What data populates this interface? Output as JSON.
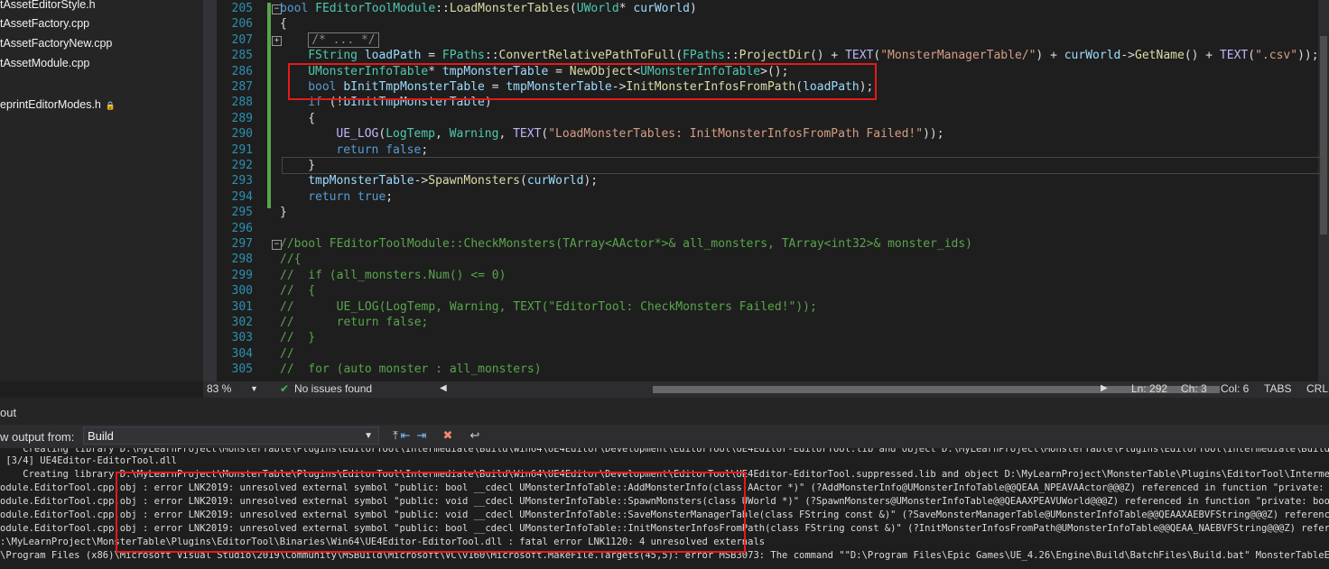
{
  "explorer": {
    "items": [
      {
        "label": "tAssetEditorStyle.h",
        "locked": false
      },
      {
        "label": "tAssetFactory.cpp",
        "locked": false
      },
      {
        "label": "tAssetFactoryNew.cpp",
        "locked": false
      },
      {
        "label": "tAssetModule.cpp",
        "locked": false
      },
      {
        "label": "eprintEditorModes.h",
        "locked": true
      }
    ]
  },
  "editor": {
    "lines": [
      {
        "n": "205",
        "segs": [
          [
            "kw",
            "bool "
          ],
          [
            "ty",
            "FEditorToolModule"
          ],
          [
            "",
            "::"
          ],
          [
            "fn",
            "LoadMonsterTables"
          ],
          [
            "",
            "("
          ],
          [
            "ty",
            "UWorld"
          ],
          [
            "",
            "* "
          ],
          [
            "var",
            "curWorld"
          ],
          [
            "",
            ")"
          ]
        ]
      },
      {
        "n": "206",
        "segs": [
          [
            "",
            "{"
          ]
        ]
      },
      {
        "n": "207",
        "segs": [
          [
            "box",
            "/* ... */"
          ]
        ]
      },
      {
        "n": "285",
        "segs": [
          [
            "ty",
            "FString "
          ],
          [
            "var",
            "loadPath"
          ],
          [
            "",
            " = "
          ],
          [
            "ty",
            "FPaths"
          ],
          [
            "",
            "::"
          ],
          [
            "fn",
            "ConvertRelativePathToFull"
          ],
          [
            "",
            "("
          ],
          [
            "ty",
            "FPaths"
          ],
          [
            "",
            "::"
          ],
          [
            "fn",
            "ProjectDir"
          ],
          [
            "",
            "() + "
          ],
          [
            "mac",
            "TEXT"
          ],
          [
            "",
            "("
          ],
          [
            "str",
            "\"MonsterManagerTable/\""
          ],
          [
            "",
            ") + "
          ],
          [
            "var",
            "curWorld"
          ],
          [
            "",
            "->"
          ],
          [
            "fn",
            "GetName"
          ],
          [
            "",
            "() + "
          ],
          [
            "mac",
            "TEXT"
          ],
          [
            "",
            "("
          ],
          [
            "str",
            "\".csv\""
          ],
          [
            "",
            "));"
          ]
        ]
      },
      {
        "n": "286",
        "segs": [
          [
            "ty",
            "UMonsterInfoTable"
          ],
          [
            "",
            "* "
          ],
          [
            "var",
            "tmpMonsterTable"
          ],
          [
            "",
            " = "
          ],
          [
            "fn",
            "NewObject"
          ],
          [
            "",
            "<"
          ],
          [
            "ty",
            "UMonsterInfoTable"
          ],
          [
            "",
            ">();"
          ]
        ]
      },
      {
        "n": "287",
        "segs": [
          [
            "kw",
            "bool "
          ],
          [
            "var",
            "bInitTmpMonsterTable"
          ],
          [
            "",
            " = "
          ],
          [
            "var",
            "tmpMonsterTable"
          ],
          [
            "",
            "->"
          ],
          [
            "fn",
            "InitMonsterInfosFromPath"
          ],
          [
            "",
            "("
          ],
          [
            "var",
            "loadPath"
          ],
          [
            "",
            ");"
          ]
        ]
      },
      {
        "n": "288",
        "segs": [
          [
            "kw",
            "if "
          ],
          [
            "",
            "(!"
          ],
          [
            "var",
            "bInitTmpMonsterTable"
          ],
          [
            "",
            ")"
          ]
        ]
      },
      {
        "n": "289",
        "segs": [
          [
            "",
            "{"
          ]
        ]
      },
      {
        "n": "290",
        "segs": [
          [
            "mac",
            "UE_LOG"
          ],
          [
            "",
            "("
          ],
          [
            "ty",
            "LogTemp"
          ],
          [
            "",
            ", "
          ],
          [
            "ty",
            "Warning"
          ],
          [
            "",
            ", "
          ],
          [
            "mac",
            "TEXT"
          ],
          [
            "",
            "("
          ],
          [
            "str",
            "\"LoadMonsterTables: InitMonsterInfosFromPath Failed!\""
          ],
          [
            "",
            "));"
          ]
        ]
      },
      {
        "n": "291",
        "segs": [
          [
            "kw",
            "return "
          ],
          [
            "kw",
            "false"
          ],
          [
            "",
            ";"
          ]
        ]
      },
      {
        "n": "292",
        "segs": [
          [
            "",
            "}"
          ]
        ]
      },
      {
        "n": "293",
        "segs": [
          [
            "var",
            "tmpMonsterTable"
          ],
          [
            "",
            "->"
          ],
          [
            "fn",
            "SpawnMonsters"
          ],
          [
            "",
            "("
          ],
          [
            "var",
            "curWorld"
          ],
          [
            "",
            ");"
          ]
        ]
      },
      {
        "n": "294",
        "segs": [
          [
            "kw",
            "return "
          ],
          [
            "kw",
            "true"
          ],
          [
            "",
            ";"
          ]
        ]
      },
      {
        "n": "295",
        "segs": [
          [
            "",
            "}"
          ]
        ]
      },
      {
        "n": "296",
        "segs": []
      },
      {
        "n": "297",
        "segs": [
          [
            "cm",
            "//bool FEditorToolModule::CheckMonsters(TArray<AActor*>& all_monsters, TArray<int32>& monster_ids)"
          ]
        ]
      },
      {
        "n": "298",
        "segs": [
          [
            "cm",
            "//{"
          ]
        ]
      },
      {
        "n": "299",
        "segs": [
          [
            "cm",
            "//  if (all_monsters.Num() <= 0)"
          ]
        ]
      },
      {
        "n": "300",
        "segs": [
          [
            "cm",
            "//  {"
          ]
        ]
      },
      {
        "n": "301",
        "segs": [
          [
            "cm",
            "//      UE_LOG(LogTemp, Warning, TEXT(\"EditorTool: CheckMonsters Failed!\"));"
          ]
        ]
      },
      {
        "n": "302",
        "segs": [
          [
            "cm",
            "//      return false;"
          ]
        ]
      },
      {
        "n": "303",
        "segs": [
          [
            "cm",
            "//  }"
          ]
        ]
      },
      {
        "n": "304",
        "segs": [
          [
            "cm",
            "//"
          ]
        ]
      },
      {
        "n": "305",
        "segs": [
          [
            "cm",
            "//  for (auto monster : all_monsters)"
          ]
        ]
      }
    ]
  },
  "status": {
    "zoom": "83 %",
    "issues": "No issues found",
    "ln": "Ln: 292",
    "ch": "Ch: 3",
    "col": "Col: 6",
    "tabs": "TABS",
    "eol": "CRLF"
  },
  "output": {
    "title": "out",
    "from_label": "w output from:",
    "source": "Build",
    "lines": [
      "    Creating library D:\\MyLearnProject\\MonsterTable\\Plugins\\EditorTool\\Intermediate\\Build\\Win64\\UE4Editor\\Development\\EditorTool\\UE4Editor-EditorTool.lib and object D:\\MyLearnProject\\MonsterTable\\Plugins\\EditorTool\\Intermediate\\Build\\Win64\\UE4Edi",
      " [3/4] UE4Editor-EditorTool.dll",
      "    Creating library D:\\MyLearnProject\\MonsterTable\\Plugins\\EditorTool\\Intermediate\\Build\\Win64\\UE4Editor\\Development\\EditorTool\\UE4Editor-EditorTool.suppressed.lib and object D:\\MyLearnProject\\MonsterTable\\Plugins\\EditorTool\\Intermediate\\Build\\",
      "odule.EditorTool.cpp.obj : error LNK2019: unresolved external symbol \"public: bool __cdecl UMonsterInfoTable::AddMonsterInfo(class AActor *)\" (?AddMonsterInfo@UMonsterInfoTable@@QEAA_NPEAVAActor@@@Z) referenced in function \"private: bool __cdecl",
      "odule.EditorTool.cpp.obj : error LNK2019: unresolved external symbol \"public: void __cdecl UMonsterInfoTable::SpawnMonsters(class UWorld *)\" (?SpawnMonsters@UMonsterInfoTable@@QEAAXPEAVUWorld@@@Z) referenced in function \"private: bool __cdecl FE",
      "odule.EditorTool.cpp.obj : error LNK2019: unresolved external symbol \"public: void __cdecl UMonsterInfoTable::SaveMonsterManagerTable(class FString const &)\" (?SaveMonsterManagerTable@UMonsterInfoTable@@QEAAXAEBVFString@@@Z) referenced in functi",
      "odule.EditorTool.cpp.obj : error LNK2019: unresolved external symbol \"public: bool __cdecl UMonsterInfoTable::InitMonsterInfosFromPath(class FString const &)\" (?InitMonsterInfosFromPath@UMonsterInfoTable@@QEAA_NAEBVFString@@@Z) referenced in func",
      ":\\MyLearnProject\\MonsterTable\\Plugins\\EditorTool\\Binaries\\Win64\\UE4Editor-EditorTool.dll : fatal error LNK1120: 4 unresolved externals",
      "\\Program Files (x86)\\Microsoft Visual Studio\\2019\\Community\\MSBuild\\Microsoft\\VC\\v160\\Microsoft.MakeFile.Targets(45,5): error MSB3073: The command \"\"D:\\Program Files\\Epic Games\\UE_4.26\\Engine\\Build\\BatchFiles\\Build.bat\" MonsterTableEditor Win64"
    ]
  },
  "colors": {
    "highlight": "#e5191b",
    "editor_bg": "#1e1e1e",
    "line_number": "#2b91af"
  }
}
